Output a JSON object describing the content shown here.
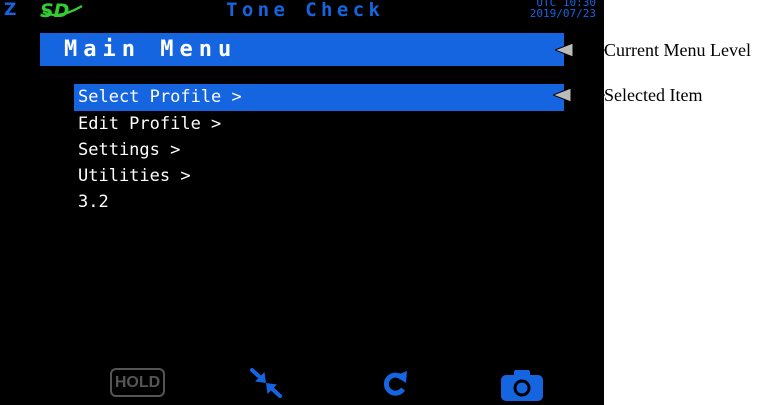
{
  "status_bar": {
    "z_indicator": "Z",
    "sd_icon": "sd-card-icon",
    "title": "Tone Check",
    "clock_line1": "UTC 10:30",
    "clock_line2": "2019/07/23"
  },
  "menu": {
    "header": "Main Menu",
    "items": [
      {
        "label": "Select Profile >",
        "selected": true
      },
      {
        "label": "Edit Profile >",
        "selected": false
      },
      {
        "label": "Settings >",
        "selected": false
      },
      {
        "label": "Utilities >",
        "selected": false
      },
      {
        "label": "3.2",
        "selected": false
      }
    ]
  },
  "toolbar": {
    "hold_label": "HOLD",
    "icons": [
      "hold-button",
      "collapse-arrows-icon",
      "refresh-icon",
      "camera-icon"
    ]
  },
  "annotations": {
    "current_menu_level": "Current Menu Level",
    "selected_item": "Selected Item"
  },
  "colors": {
    "screen_bg": "#000000",
    "accent_blue": "#1565e0",
    "sd_green": "#33cc33",
    "text_white": "#ffffff",
    "disabled_gray": "#555555"
  }
}
